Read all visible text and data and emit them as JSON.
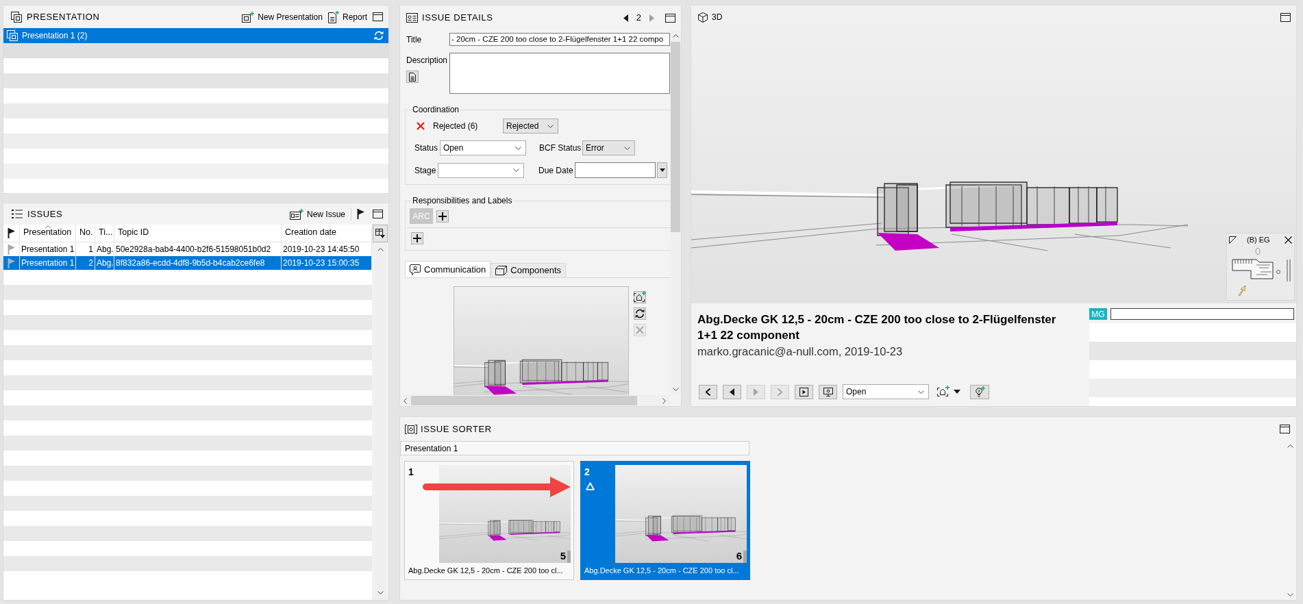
{
  "presentation_panel": {
    "title": "PRESENTATION",
    "actions": [
      {
        "kind": "new",
        "label": "New Presentation"
      },
      {
        "kind": "report",
        "label": "Report"
      }
    ],
    "items": [
      {
        "label": "Presentation 1 (2)",
        "selected": true
      }
    ]
  },
  "issues_panel": {
    "title": "ISSUES",
    "new_issue": "New Issue",
    "table": {
      "columns": [
        {
          "label": "Presentation",
          "sorted": true
        },
        {
          "label": "No.",
          "sorted": false
        },
        {
          "label": "Ti...",
          "sorted": false
        },
        {
          "label": "Topic ID",
          "sorted": false
        },
        {
          "label": "Creation date",
          "sorted": false
        }
      ],
      "rows": [
        {
          "presentation": "Presentation 1",
          "no": "1",
          "title": "Abg.",
          "topic_id": "50e2928a-bab4-4400-b2f6-51598051b0d2",
          "creation_date": "2019-10-23 14:45:50",
          "selected": false
        },
        {
          "presentation": "Presentation 1",
          "no": "2",
          "title": "Abg.",
          "topic_id": "8f832a86-ecdd-4df8-9b5d-b4cab2ce6fe8",
          "creation_date": "2019-10-23 15:00:35",
          "selected": true
        }
      ]
    }
  },
  "issue_details": {
    "title": "ISSUE DETAILS",
    "pager": {
      "page": "2",
      "previous_disabled": false,
      "next_disabled": true
    },
    "title_label": "Title",
    "title_value": "- 20cm - CZE 200 too close to 2-Flügelfenster 1+1 22 compo",
    "description_label": "Description",
    "coordination": {
      "legend": "Coordination",
      "state_label": "Rejected (6)",
      "state_value": "Rejected",
      "status_label": "Status",
      "status_value": "Open",
      "bcf_status_label": "BCF Status",
      "bcf_status_value": "Error",
      "stage_label": "Stage",
      "due_date_label": "Due Date"
    },
    "responsibilities": {
      "legend": "Responsibilities and Labels",
      "tags": [
        {
          "label": "ARC"
        }
      ]
    },
    "tabs": [
      {
        "label": "Communication",
        "selected": true
      },
      {
        "label": "Components",
        "selected": false
      }
    ],
    "viewpoint_buttons": [
      {
        "kind": "add",
        "disabled": false
      },
      {
        "kind": "refresh",
        "disabled": false
      },
      {
        "kind": "delete",
        "disabled": true
      }
    ]
  },
  "viewer_3d": {
    "title": "3D",
    "minimap": {
      "floor": "(B) EG"
    },
    "issue_card": {
      "title": "Abg.Decke GK 12,5 - 20cm - CZE 200 too close to 2-Flügelfenster 1+1 22 component",
      "meta": "marko.gracanic@a-null.com, 2019-10-23",
      "nav_buttons": [
        {
          "kind": "back",
          "disabled": false
        },
        {
          "kind": "previous",
          "disabled": false
        },
        {
          "kind": "next",
          "disabled": true
        },
        {
          "kind": "forward",
          "disabled": true
        },
        {
          "kind": "play",
          "disabled": false
        },
        {
          "kind": "present",
          "disabled": false
        }
      ],
      "status_value": "Open",
      "comment_author": "MG"
    }
  },
  "issue_sorter": {
    "title": "ISSUE SORTER",
    "group": "Presentation 1",
    "cards": [
      {
        "number": "1",
        "count": "5",
        "caption": "Abg.Decke GK 12,5 - 20cm - CZE 200 too cl...",
        "selected": false,
        "alert": false
      },
      {
        "number": "2",
        "count": "6",
        "caption": "Abg.Decke GK 12,5 - 20cm - CZE 200 too cl...",
        "selected": true,
        "alert": true
      }
    ]
  }
}
